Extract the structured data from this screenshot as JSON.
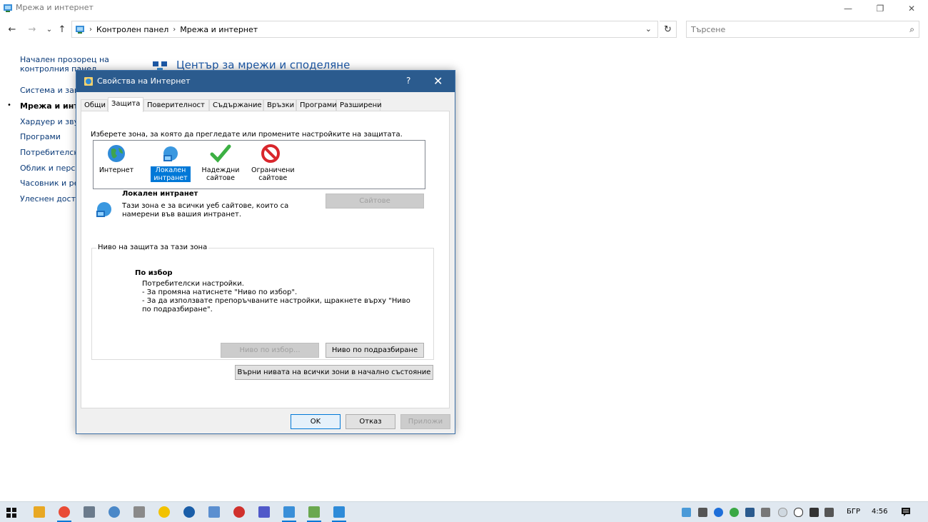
{
  "window": {
    "title": "Мрежа и интернет",
    "minimize": "—",
    "maximize": "❐",
    "close": "✕"
  },
  "nav": {
    "back": "←",
    "forward": "→",
    "recent": "⌄",
    "up": "↑"
  },
  "address": {
    "crumbs": [
      "Контролен панел",
      "Мрежа и интернет"
    ],
    "separator": "›",
    "dropdown": "⌄",
    "refresh": "↻"
  },
  "search": {
    "placeholder": "Търсене",
    "icon": "⌕"
  },
  "sidebar": {
    "items": [
      {
        "label": "Начален прозорец на"
      },
      {
        "label": "контролния панел"
      },
      {
        "label": "Система и защ"
      },
      {
        "label": "Мрежа и инте"
      },
      {
        "label": "Хардуер и звук"
      },
      {
        "label": "Програми"
      },
      {
        "label": "Потребителски"
      },
      {
        "label": "Облик и персо"
      },
      {
        "label": "Часовник и рег"
      },
      {
        "label": "Улеснен дость"
      }
    ],
    "bullet": "•"
  },
  "content": {
    "heading": "Център за мрежи и споделяне"
  },
  "dialog": {
    "title": "Свойства на Интернет",
    "help": "?",
    "close": "✕",
    "tabs": [
      "Общи",
      "Защита",
      "Поверителност",
      "Съдържание",
      "Връзки",
      "Програми",
      "Разширени"
    ],
    "zone_prompt": "Изберете зона, за която да прегледате или промените настройките на защитата.",
    "zones": [
      {
        "label": "Интернет",
        "icon": "globe-icon"
      },
      {
        "label": "Локален интранет",
        "icon": "intranet-icon"
      },
      {
        "label": "Надеждни сайтове",
        "icon": "checkmark-icon"
      },
      {
        "label": "Ограничени сайтове",
        "icon": "no-entry-icon"
      }
    ],
    "selected_zone": {
      "name": "Локален интранет",
      "description": "Тази зона е за всички уеб сайтове, които са намерени във вашия интранет.",
      "sites_button": "Сайтове"
    },
    "security_level": {
      "legend": "Ниво на защита за тази зона",
      "title": "По избор",
      "lines": [
        "Потребителски настройки.",
        "- За промяна натиснете \"Ниво по избор\".",
        "- За да използвате препоръчваните настройки, щракнете върху \"Ниво по подразбиране\"."
      ],
      "custom_button": "Ниво по избор...",
      "default_button": "Ниво по подразбиране"
    },
    "reset_all_button": "Върни нивата на всички зони в начално състояние",
    "ok": "OK",
    "cancel": "Отказ",
    "apply": "Приложи"
  },
  "taskbar": {
    "language": "БГР",
    "time": "4:56"
  },
  "colors": {
    "dialog_title": "#2b5b8e",
    "accent": "#0078d7",
    "link": "#0a3a78",
    "heading": "#1e5aa8"
  }
}
